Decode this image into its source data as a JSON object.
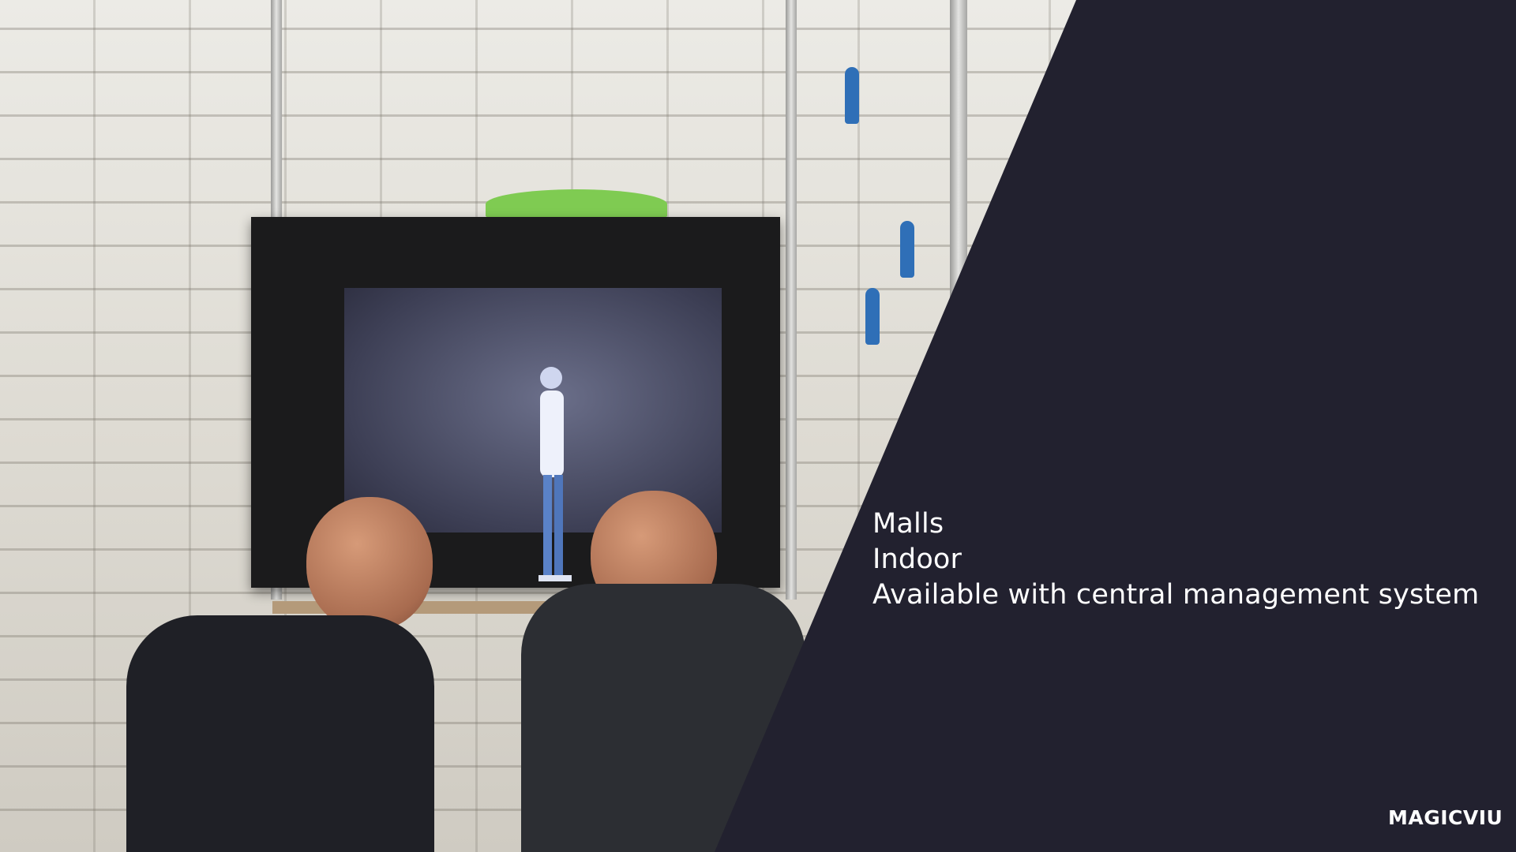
{
  "slide": {
    "lines": [
      "Malls",
      "Indoor",
      "Available with central management system"
    ],
    "brand": "MAGICVIU"
  },
  "colors": {
    "panel": "#22212f",
    "text": "#ffffff"
  },
  "photo": {
    "subject": "hologram-display-photo"
  }
}
